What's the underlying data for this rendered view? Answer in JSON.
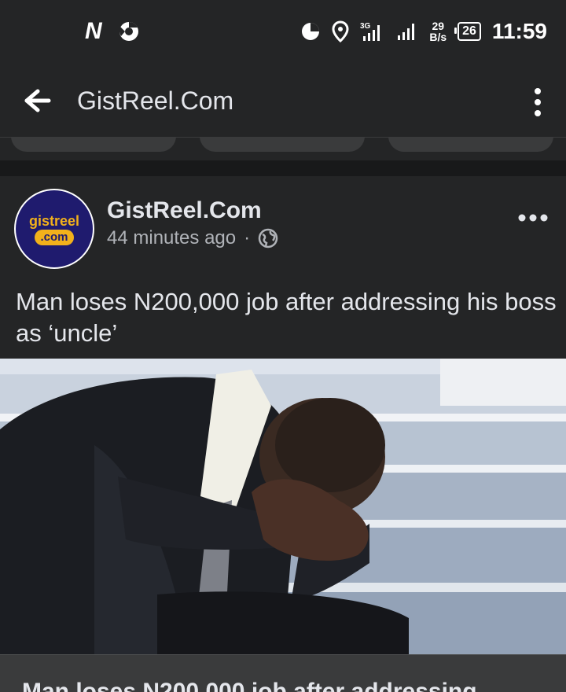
{
  "status_bar": {
    "app_n_label": "N",
    "speed_value": "29",
    "speed_unit": "B/s",
    "network_label": "3G",
    "battery": "26",
    "time": "11:59"
  },
  "app_bar": {
    "title": "GistReel.Com"
  },
  "post": {
    "avatar_line1": "gistreel",
    "avatar_line2": ".com",
    "page_name": "GistReel.Com",
    "time_ago": "44 minutes ago",
    "separator": "·",
    "caption": "Man loses N200,000 job after addressing his boss as ‘uncle’",
    "link_title": "Man loses N200,000 job after addressing"
  },
  "colors": {
    "background": "#242526",
    "divider": "#18191a",
    "text_primary": "#e4e6eb",
    "text_secondary": "#b0b3b8",
    "avatar_bg": "#1f1b6e",
    "avatar_accent": "#f2b11b"
  },
  "icons": {
    "back": "arrow-left-icon",
    "more": "vertical-dots-icon",
    "post_options": "horizontal-dots-icon",
    "privacy": "globe-icon"
  }
}
